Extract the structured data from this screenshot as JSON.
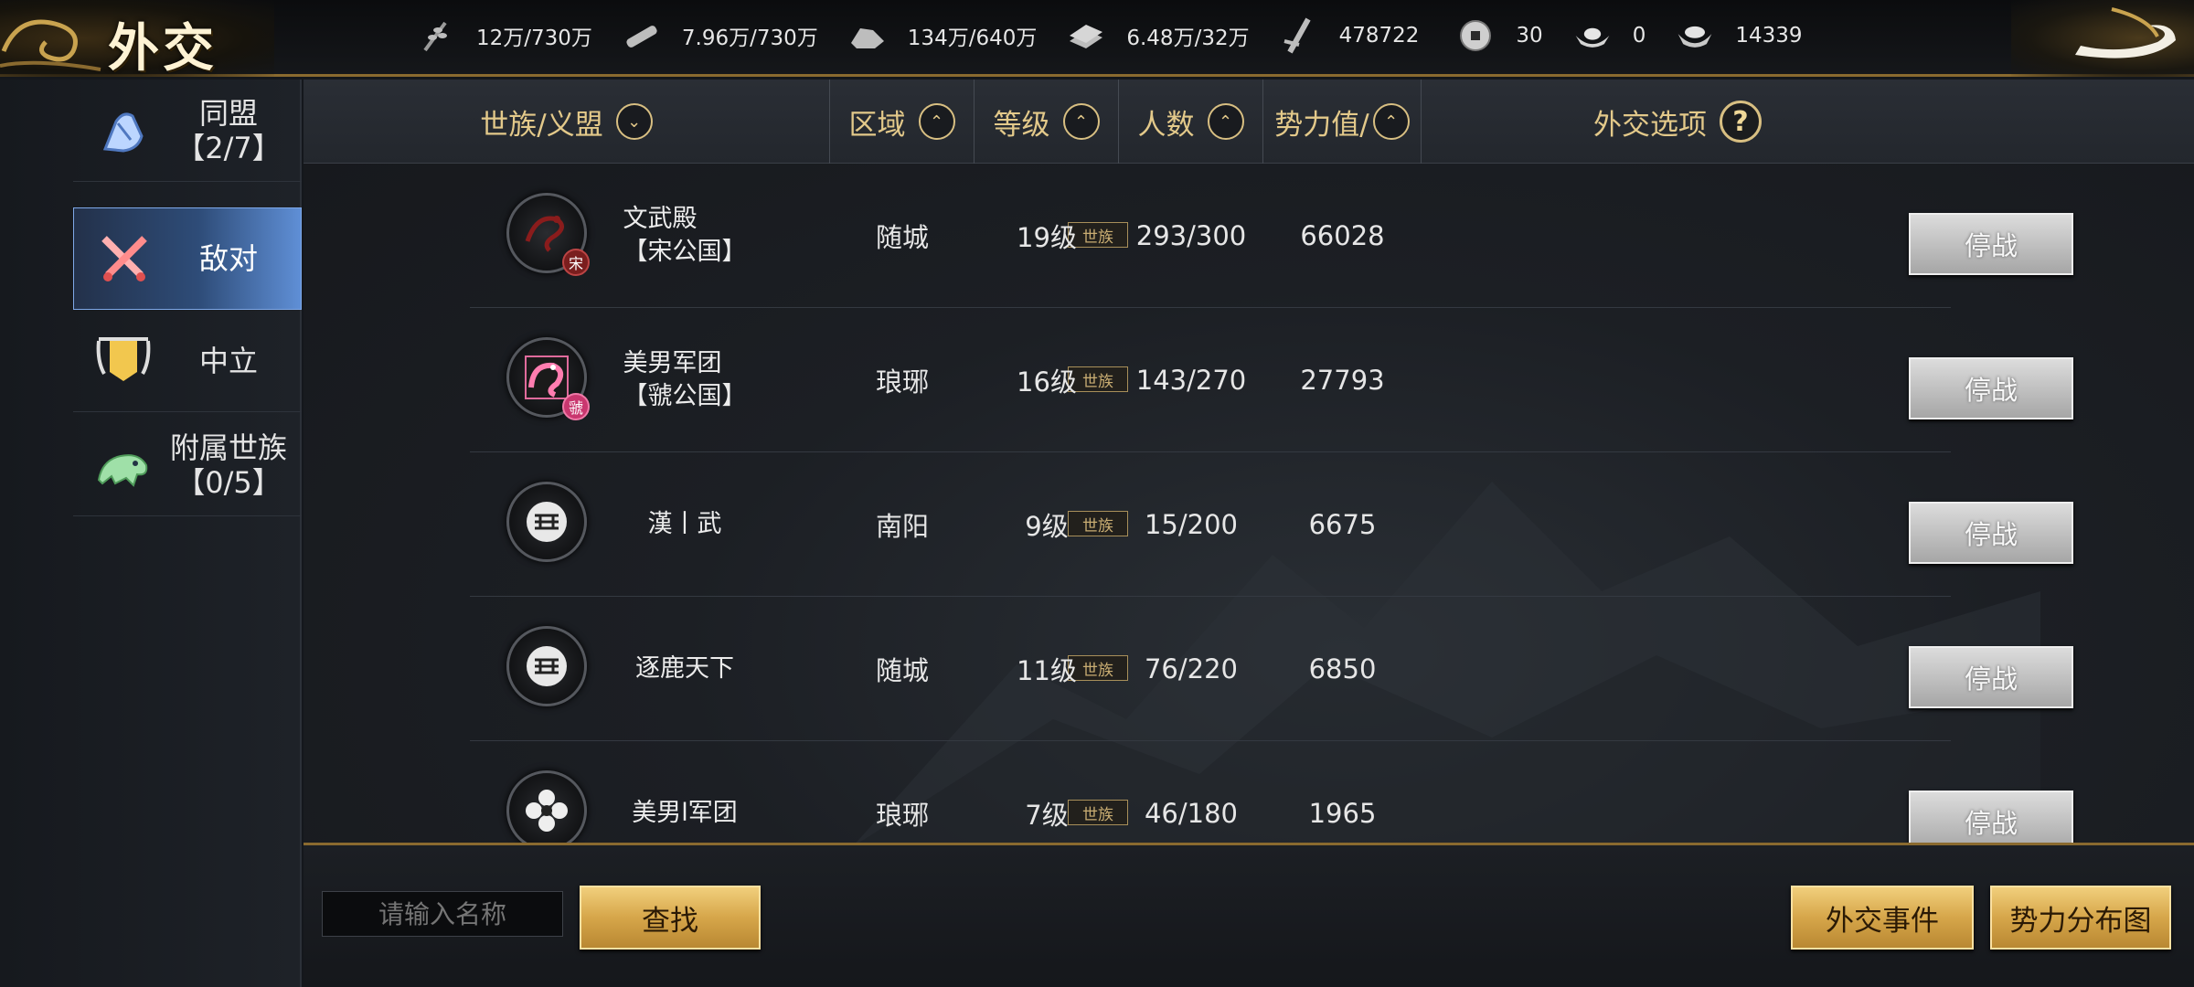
{
  "header": {
    "title": "外交",
    "resources": [
      {
        "icon": "grain-icon",
        "text": "12万/730万"
      },
      {
        "icon": "wood-icon",
        "text": "7.96万/730万"
      },
      {
        "icon": "stone-icon",
        "text": "134万/640万"
      },
      {
        "icon": "iron-icon",
        "text": "6.48万/32万"
      },
      {
        "icon": "decree-icon",
        "text": "478722"
      },
      {
        "icon": "coin-icon",
        "text": "30"
      },
      {
        "icon": "gold-ingot-icon",
        "text": "0"
      },
      {
        "icon": "silver-ingot-icon",
        "text": "14339"
      }
    ]
  },
  "sidebar": {
    "items": [
      {
        "label": "同盟",
        "sub": "【2/7】",
        "icon": "alliance-hands-icon",
        "active": false
      },
      {
        "label": "敌对",
        "sub": "",
        "icon": "crossed-swords-icon",
        "active": true
      },
      {
        "label": "中立",
        "sub": "",
        "icon": "banner-icon",
        "active": false
      },
      {
        "label": "附属世族",
        "sub": "【0/5】",
        "icon": "vassal-beast-icon",
        "active": false
      }
    ]
  },
  "table": {
    "headers": {
      "clan": "世族/义盟",
      "region": "区域",
      "level": "等级",
      "members": "人数",
      "power": "势力值/",
      "options": "外交选项"
    },
    "rows": [
      {
        "name_line1": "文武殿",
        "name_line2": "【宋公国】",
        "tag": "世族",
        "region": "随城",
        "level": "19级",
        "members": "293/300",
        "power": "66028",
        "action": "停战",
        "badge": "宋"
      },
      {
        "name_line1": "美男军团",
        "name_line2": "【虢公国】",
        "tag": "世族",
        "region": "琅琊",
        "level": "16级",
        "members": "143/270",
        "power": "27793",
        "action": "停战",
        "badge": "虢"
      },
      {
        "name_line1": "漢丨武",
        "name_line2": "",
        "tag": "世族",
        "region": "南阳",
        "level": "9级",
        "members": "15/200",
        "power": "6675",
        "action": "停战",
        "badge": ""
      },
      {
        "name_line1": "逐鹿天下",
        "name_line2": "",
        "tag": "世族",
        "region": "随城",
        "level": "11级",
        "members": "76/220",
        "power": "6850",
        "action": "停战",
        "badge": ""
      },
      {
        "name_line1": "美男l军团",
        "name_line2": "",
        "tag": "世族",
        "region": "琅琊",
        "level": "7级",
        "members": "46/180",
        "power": "1965",
        "action": "停战",
        "badge": ""
      }
    ]
  },
  "footer": {
    "search_placeholder": "请输入名称",
    "search_button": "查找",
    "events_button": "外交事件",
    "map_button": "势力分布图"
  },
  "colors": {
    "gold_text": "#e3c98a",
    "active_tab": "#2e4c78",
    "button_gold": "#d6a64a",
    "button_gray": "#bdbdbd"
  }
}
